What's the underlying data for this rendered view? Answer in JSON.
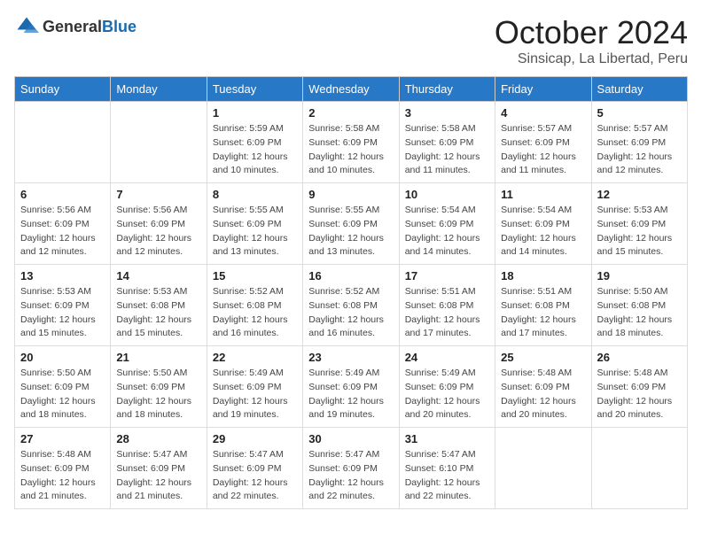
{
  "header": {
    "logo_general": "General",
    "logo_blue": "Blue",
    "month_title": "October 2024",
    "location": "Sinsicap, La Libertad, Peru"
  },
  "calendar": {
    "days_of_week": [
      "Sunday",
      "Monday",
      "Tuesday",
      "Wednesday",
      "Thursday",
      "Friday",
      "Saturday"
    ],
    "weeks": [
      [
        {
          "day": "",
          "detail": ""
        },
        {
          "day": "",
          "detail": ""
        },
        {
          "day": "1",
          "detail": "Sunrise: 5:59 AM\nSunset: 6:09 PM\nDaylight: 12 hours\nand 10 minutes."
        },
        {
          "day": "2",
          "detail": "Sunrise: 5:58 AM\nSunset: 6:09 PM\nDaylight: 12 hours\nand 10 minutes."
        },
        {
          "day": "3",
          "detail": "Sunrise: 5:58 AM\nSunset: 6:09 PM\nDaylight: 12 hours\nand 11 minutes."
        },
        {
          "day": "4",
          "detail": "Sunrise: 5:57 AM\nSunset: 6:09 PM\nDaylight: 12 hours\nand 11 minutes."
        },
        {
          "day": "5",
          "detail": "Sunrise: 5:57 AM\nSunset: 6:09 PM\nDaylight: 12 hours\nand 12 minutes."
        }
      ],
      [
        {
          "day": "6",
          "detail": "Sunrise: 5:56 AM\nSunset: 6:09 PM\nDaylight: 12 hours\nand 12 minutes."
        },
        {
          "day": "7",
          "detail": "Sunrise: 5:56 AM\nSunset: 6:09 PM\nDaylight: 12 hours\nand 12 minutes."
        },
        {
          "day": "8",
          "detail": "Sunrise: 5:55 AM\nSunset: 6:09 PM\nDaylight: 12 hours\nand 13 minutes."
        },
        {
          "day": "9",
          "detail": "Sunrise: 5:55 AM\nSunset: 6:09 PM\nDaylight: 12 hours\nand 13 minutes."
        },
        {
          "day": "10",
          "detail": "Sunrise: 5:54 AM\nSunset: 6:09 PM\nDaylight: 12 hours\nand 14 minutes."
        },
        {
          "day": "11",
          "detail": "Sunrise: 5:54 AM\nSunset: 6:09 PM\nDaylight: 12 hours\nand 14 minutes."
        },
        {
          "day": "12",
          "detail": "Sunrise: 5:53 AM\nSunset: 6:09 PM\nDaylight: 12 hours\nand 15 minutes."
        }
      ],
      [
        {
          "day": "13",
          "detail": "Sunrise: 5:53 AM\nSunset: 6:09 PM\nDaylight: 12 hours\nand 15 minutes."
        },
        {
          "day": "14",
          "detail": "Sunrise: 5:53 AM\nSunset: 6:08 PM\nDaylight: 12 hours\nand 15 minutes."
        },
        {
          "day": "15",
          "detail": "Sunrise: 5:52 AM\nSunset: 6:08 PM\nDaylight: 12 hours\nand 16 minutes."
        },
        {
          "day": "16",
          "detail": "Sunrise: 5:52 AM\nSunset: 6:08 PM\nDaylight: 12 hours\nand 16 minutes."
        },
        {
          "day": "17",
          "detail": "Sunrise: 5:51 AM\nSunset: 6:08 PM\nDaylight: 12 hours\nand 17 minutes."
        },
        {
          "day": "18",
          "detail": "Sunrise: 5:51 AM\nSunset: 6:08 PM\nDaylight: 12 hours\nand 17 minutes."
        },
        {
          "day": "19",
          "detail": "Sunrise: 5:50 AM\nSunset: 6:08 PM\nDaylight: 12 hours\nand 18 minutes."
        }
      ],
      [
        {
          "day": "20",
          "detail": "Sunrise: 5:50 AM\nSunset: 6:09 PM\nDaylight: 12 hours\nand 18 minutes."
        },
        {
          "day": "21",
          "detail": "Sunrise: 5:50 AM\nSunset: 6:09 PM\nDaylight: 12 hours\nand 18 minutes."
        },
        {
          "day": "22",
          "detail": "Sunrise: 5:49 AM\nSunset: 6:09 PM\nDaylight: 12 hours\nand 19 minutes."
        },
        {
          "day": "23",
          "detail": "Sunrise: 5:49 AM\nSunset: 6:09 PM\nDaylight: 12 hours\nand 19 minutes."
        },
        {
          "day": "24",
          "detail": "Sunrise: 5:49 AM\nSunset: 6:09 PM\nDaylight: 12 hours\nand 20 minutes."
        },
        {
          "day": "25",
          "detail": "Sunrise: 5:48 AM\nSunset: 6:09 PM\nDaylight: 12 hours\nand 20 minutes."
        },
        {
          "day": "26",
          "detail": "Sunrise: 5:48 AM\nSunset: 6:09 PM\nDaylight: 12 hours\nand 20 minutes."
        }
      ],
      [
        {
          "day": "27",
          "detail": "Sunrise: 5:48 AM\nSunset: 6:09 PM\nDaylight: 12 hours\nand 21 minutes."
        },
        {
          "day": "28",
          "detail": "Sunrise: 5:47 AM\nSunset: 6:09 PM\nDaylight: 12 hours\nand 21 minutes."
        },
        {
          "day": "29",
          "detail": "Sunrise: 5:47 AM\nSunset: 6:09 PM\nDaylight: 12 hours\nand 22 minutes."
        },
        {
          "day": "30",
          "detail": "Sunrise: 5:47 AM\nSunset: 6:09 PM\nDaylight: 12 hours\nand 22 minutes."
        },
        {
          "day": "31",
          "detail": "Sunrise: 5:47 AM\nSunset: 6:10 PM\nDaylight: 12 hours\nand 22 minutes."
        },
        {
          "day": "",
          "detail": ""
        },
        {
          "day": "",
          "detail": ""
        }
      ]
    ]
  }
}
